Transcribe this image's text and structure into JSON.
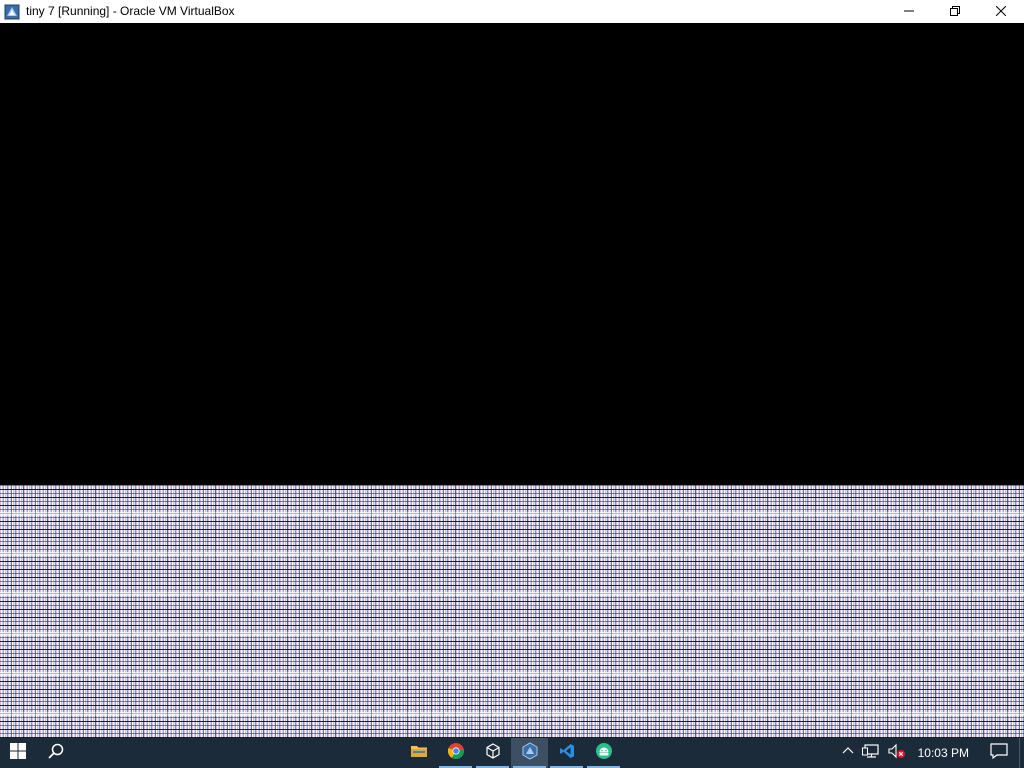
{
  "window": {
    "title": "tiny 7 [Running] - Oracle VM VirtualBox",
    "icon": "virtualbox-vm-icon",
    "controls": {
      "minimize_icon": "minimize-icon",
      "restore_icon": "restore-icon",
      "close_icon": "close-icon"
    }
  },
  "vm_display": {
    "state": "Running",
    "top_region": "black",
    "bottom_region": "corrupted-graphics"
  },
  "taskbar": {
    "start_icon": "windows-start-icon",
    "search_icon": "search-icon",
    "apps": [
      {
        "name": "File Explorer",
        "icon": "folder-icon",
        "running": false,
        "active": false
      },
      {
        "name": "Google Chrome",
        "icon": "chrome-icon",
        "running": true,
        "active": false
      },
      {
        "name": "3D Viewer",
        "icon": "cube-icon",
        "running": true,
        "active": false
      },
      {
        "name": "Oracle VM VirtualBox",
        "icon": "virtualbox-icon",
        "running": true,
        "active": true
      },
      {
        "name": "Visual Studio Code",
        "icon": "vscode-icon",
        "running": true,
        "active": false
      },
      {
        "name": "Android App",
        "icon": "android-icon",
        "running": true,
        "active": false
      }
    ],
    "tray": {
      "chevron_icon": "chevron-up-icon",
      "network_icon": "network-icon",
      "volume_icon": "volume-muted-icon",
      "clock": "10:03 PM",
      "notifications_icon": "notifications-icon"
    }
  },
  "colors": {
    "taskbar_bg": "#1c2b3a",
    "titlebar_bg": "#ffffff",
    "accent": "#7fb6e6"
  }
}
